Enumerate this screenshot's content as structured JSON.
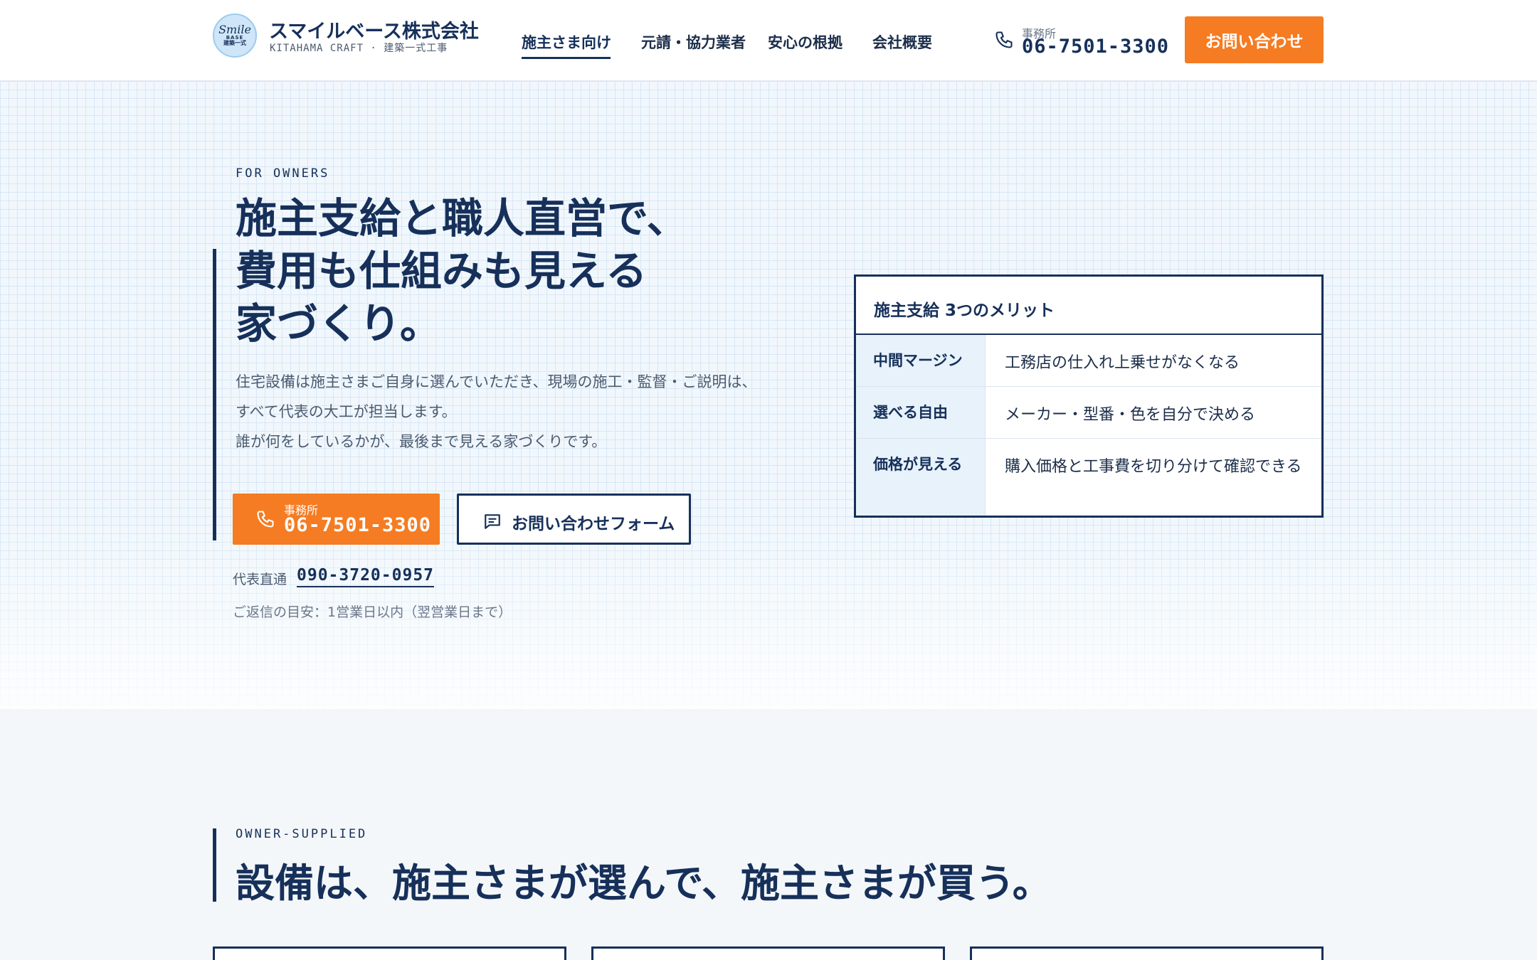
{
  "header": {
    "logo": {
      "smile": "Smile",
      "base": "BASE",
      "kanji": "建築一式"
    },
    "company_name": "スマイルベース株式会社",
    "company_sub": "KITAHAMA CRAFT · 建築一式工事",
    "nav": [
      {
        "label": "施主さま向け",
        "active": true
      },
      {
        "label": "元請・協力業者",
        "active": false
      },
      {
        "label": "安心の根拠",
        "active": false
      },
      {
        "label": "会社概要",
        "active": false
      }
    ],
    "phone_label": "事務所",
    "phone_number": "06-7501-3300",
    "cta_label": "お問い合わせ"
  },
  "hero": {
    "eyebrow": "FOR OWNERS",
    "title_lines": [
      "施主支給と職人直営で、",
      "費用も仕組みも見える",
      "家づくり。"
    ],
    "description_lines": [
      "住宅設備は施主さまご自身に選んでいただき、現場の施工・監督・ご説明は、",
      "すべて代表の大工が担当します。",
      "誰が何をしているかが、最後まで見える家づくりです。"
    ],
    "phone_button": {
      "label": "事務所",
      "number": "06-7501-3300"
    },
    "form_button_label": "お問い合わせフォーム",
    "direct_label": "代表直通",
    "direct_number": "090-3720-0957",
    "reply_note": "ご返信の目安：1営業日以内（翌営業日まで）"
  },
  "merits": {
    "title": "施主支給 3つのメリット",
    "rows": [
      {
        "key": "中間マージン",
        "value": "工務店の仕入れ上乗せがなくなる"
      },
      {
        "key": "選べる自由",
        "value": "メーカー・型番・色を自分で決める"
      },
      {
        "key": "価格が見える",
        "value": "購入価格と工事費を切り分けて確認できる"
      }
    ]
  },
  "section2": {
    "eyebrow": "OWNER-SUPPLIED",
    "title": "設備は、施主さまが選んで、施主さまが買う。"
  },
  "colors": {
    "navy": "#16305a",
    "accent": "#f57c22",
    "merit_key_bg": "#e7f2fb"
  }
}
